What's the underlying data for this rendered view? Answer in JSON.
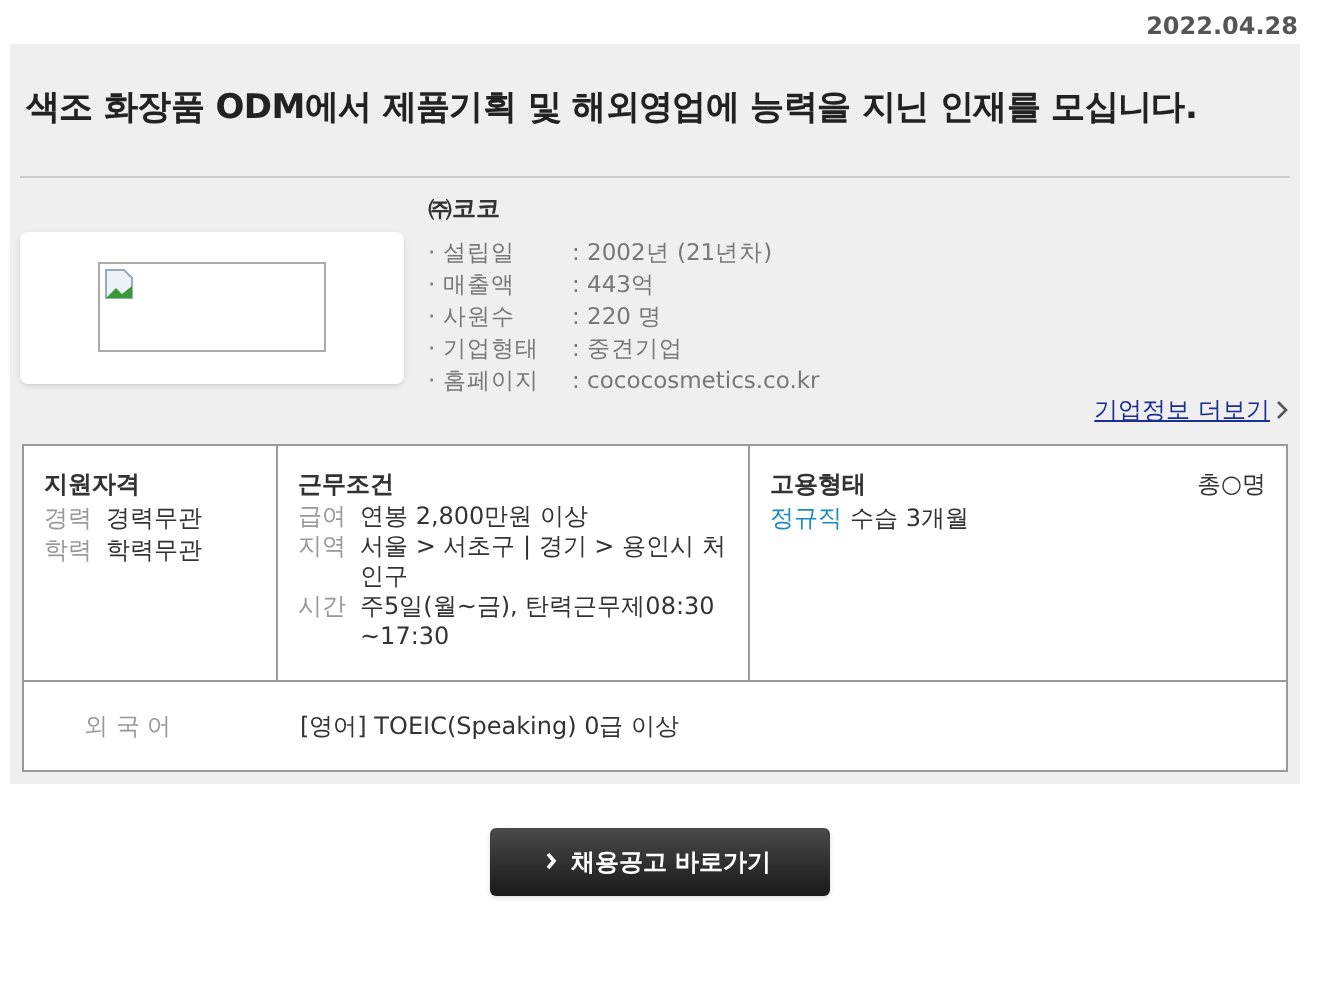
{
  "date": "2022.04.28",
  "title": "색조 화장품 ODM에서 제품기획 및 해외영업에 능력을 지닌 인재를 모십니다.",
  "company": {
    "name": "㈜코코",
    "info": [
      {
        "label": "· 설립일",
        "value": ": 2002년 (21년차)"
      },
      {
        "label": "· 매출액",
        "value": ": 443억"
      },
      {
        "label": "· 사원수",
        "value": ": 220 명"
      },
      {
        "label": "· 기업형태",
        "value": ": 중견기업"
      },
      {
        "label": "· 홈페이지",
        "value": ": cococosmetics.co.kr"
      }
    ],
    "more_link": "기업정보 더보기"
  },
  "qualifications": {
    "heading": "지원자격",
    "items": [
      {
        "label": "경력",
        "value": "경력무관"
      },
      {
        "label": "학력",
        "value": "학력무관"
      }
    ]
  },
  "conditions": {
    "heading": "근무조건",
    "items": [
      {
        "label": "급여",
        "value": "연봉 2,800만원 이상"
      },
      {
        "label": "지역",
        "value": "서울 > 서초구 | 경기 > 용인시 처인구"
      },
      {
        "label": "시간",
        "value": "주5일(월~금), 탄력근무제08:30~17:30"
      }
    ]
  },
  "employment": {
    "heading": "고용형태",
    "type": "정규직",
    "detail": "수습 3개월",
    "headcount": "총○명"
  },
  "language": {
    "label": "외 국 어",
    "value": "[영어] TOEIC(Speaking) 0급 이상"
  },
  "apply_button": "채용공고 바로가기"
}
